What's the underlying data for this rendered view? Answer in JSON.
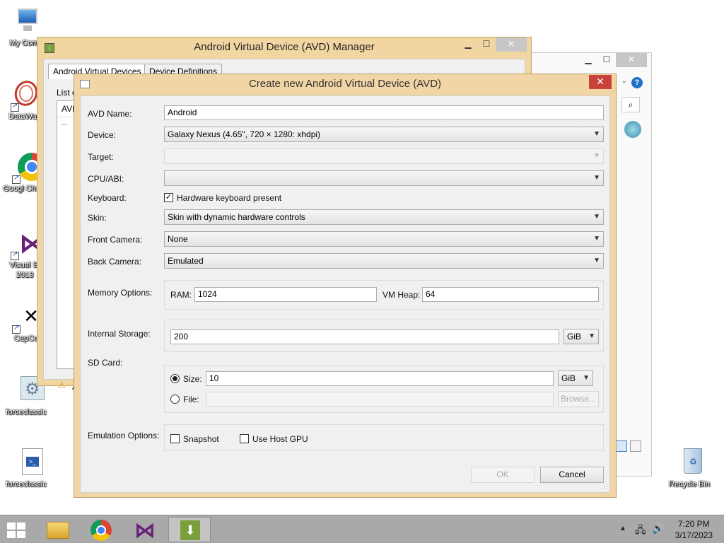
{
  "desktop": {
    "icons": [
      {
        "label": "My Comp"
      },
      {
        "label": "DataWag"
      },
      {
        "label": "Googl Chrom"
      },
      {
        "label": "Visual St 2013"
      },
      {
        "label": "CapCu"
      },
      {
        "label": "forceclassic"
      },
      {
        "label": "forceclassic"
      },
      {
        "label": "Recycle Bin"
      }
    ]
  },
  "back_window": {
    "title": "Android Virtual Device (AVD) Manager",
    "tabs": [
      "Android Virtual Devices",
      "Device Definitions"
    ],
    "list_label": "List o",
    "col_header": "AVD",
    "row_placeholder": "--",
    "warning_text": "A"
  },
  "dialog": {
    "title": "Create new Android Virtual Device (AVD)",
    "avd_name": {
      "label": "AVD Name:",
      "value": "Android"
    },
    "device": {
      "label": "Device:",
      "value": "Galaxy Nexus (4.65\", 720 × 1280: xhdpi)"
    },
    "target": {
      "label": "Target:",
      "value": ""
    },
    "cpu_abi": {
      "label": "CPU/ABI:",
      "value": ""
    },
    "keyboard": {
      "label": "Keyboard:",
      "checkbox_label": "Hardware keyboard present",
      "checked": true
    },
    "skin": {
      "label": "Skin:",
      "value": "Skin with dynamic hardware controls"
    },
    "front_camera": {
      "label": "Front Camera:",
      "value": "None"
    },
    "back_camera": {
      "label": "Back Camera:",
      "value": "Emulated"
    },
    "memory": {
      "label": "Memory Options:",
      "ram_label": "RAM:",
      "ram_value": "1024",
      "vm_heap_label": "VM Heap:",
      "vm_heap_value": "64"
    },
    "internal_storage": {
      "label": "Internal Storage:",
      "value": "200",
      "unit": "GiB"
    },
    "sd_card": {
      "label": "SD Card:",
      "size_label": "Size:",
      "size_value": "10",
      "size_unit": "GiB",
      "file_label": "File:",
      "browse_label": "Browse..."
    },
    "emulation": {
      "label": "Emulation Options:",
      "snapshot_label": "Snapshot",
      "host_gpu_label": "Use Host GPU"
    },
    "ok_label": "OK",
    "cancel_label": "Cancel"
  },
  "taskbar": {
    "time": "7:20 PM",
    "date": "3/17/2023"
  }
}
